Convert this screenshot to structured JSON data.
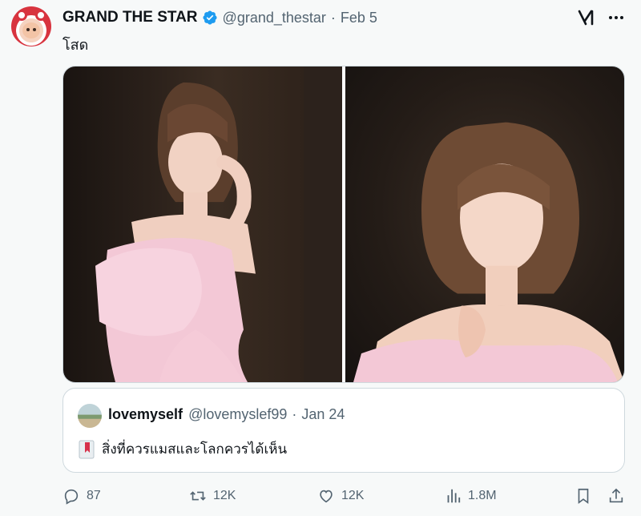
{
  "tweet": {
    "author_name": "GRAND THE STAR",
    "handle": "@grand_thestar",
    "separator": "·",
    "date": "Feb 5",
    "text": "โสด",
    "verified": true,
    "verified_color": "#1d9bf0"
  },
  "media": {
    "photos": [
      {
        "name": "photo-left",
        "description_icon": "photo"
      },
      {
        "name": "photo-right",
        "description_icon": "photo"
      }
    ]
  },
  "quote": {
    "author_name": "lovemyself",
    "handle": "@lovemyslef99",
    "separator": "·",
    "date": "Jan 24",
    "emoji_icon": "bookmark-emoji-icon",
    "text": "สิ่งที่ควรแมสและโลกควรได้เห็น"
  },
  "actions": {
    "replies": "87",
    "reposts": "12K",
    "likes": "12K",
    "views": "1.8M"
  },
  "colors": {
    "text_primary": "#0f1419",
    "text_secondary": "#536471",
    "border": "#cfd9de",
    "background": "#f7f9f9"
  }
}
